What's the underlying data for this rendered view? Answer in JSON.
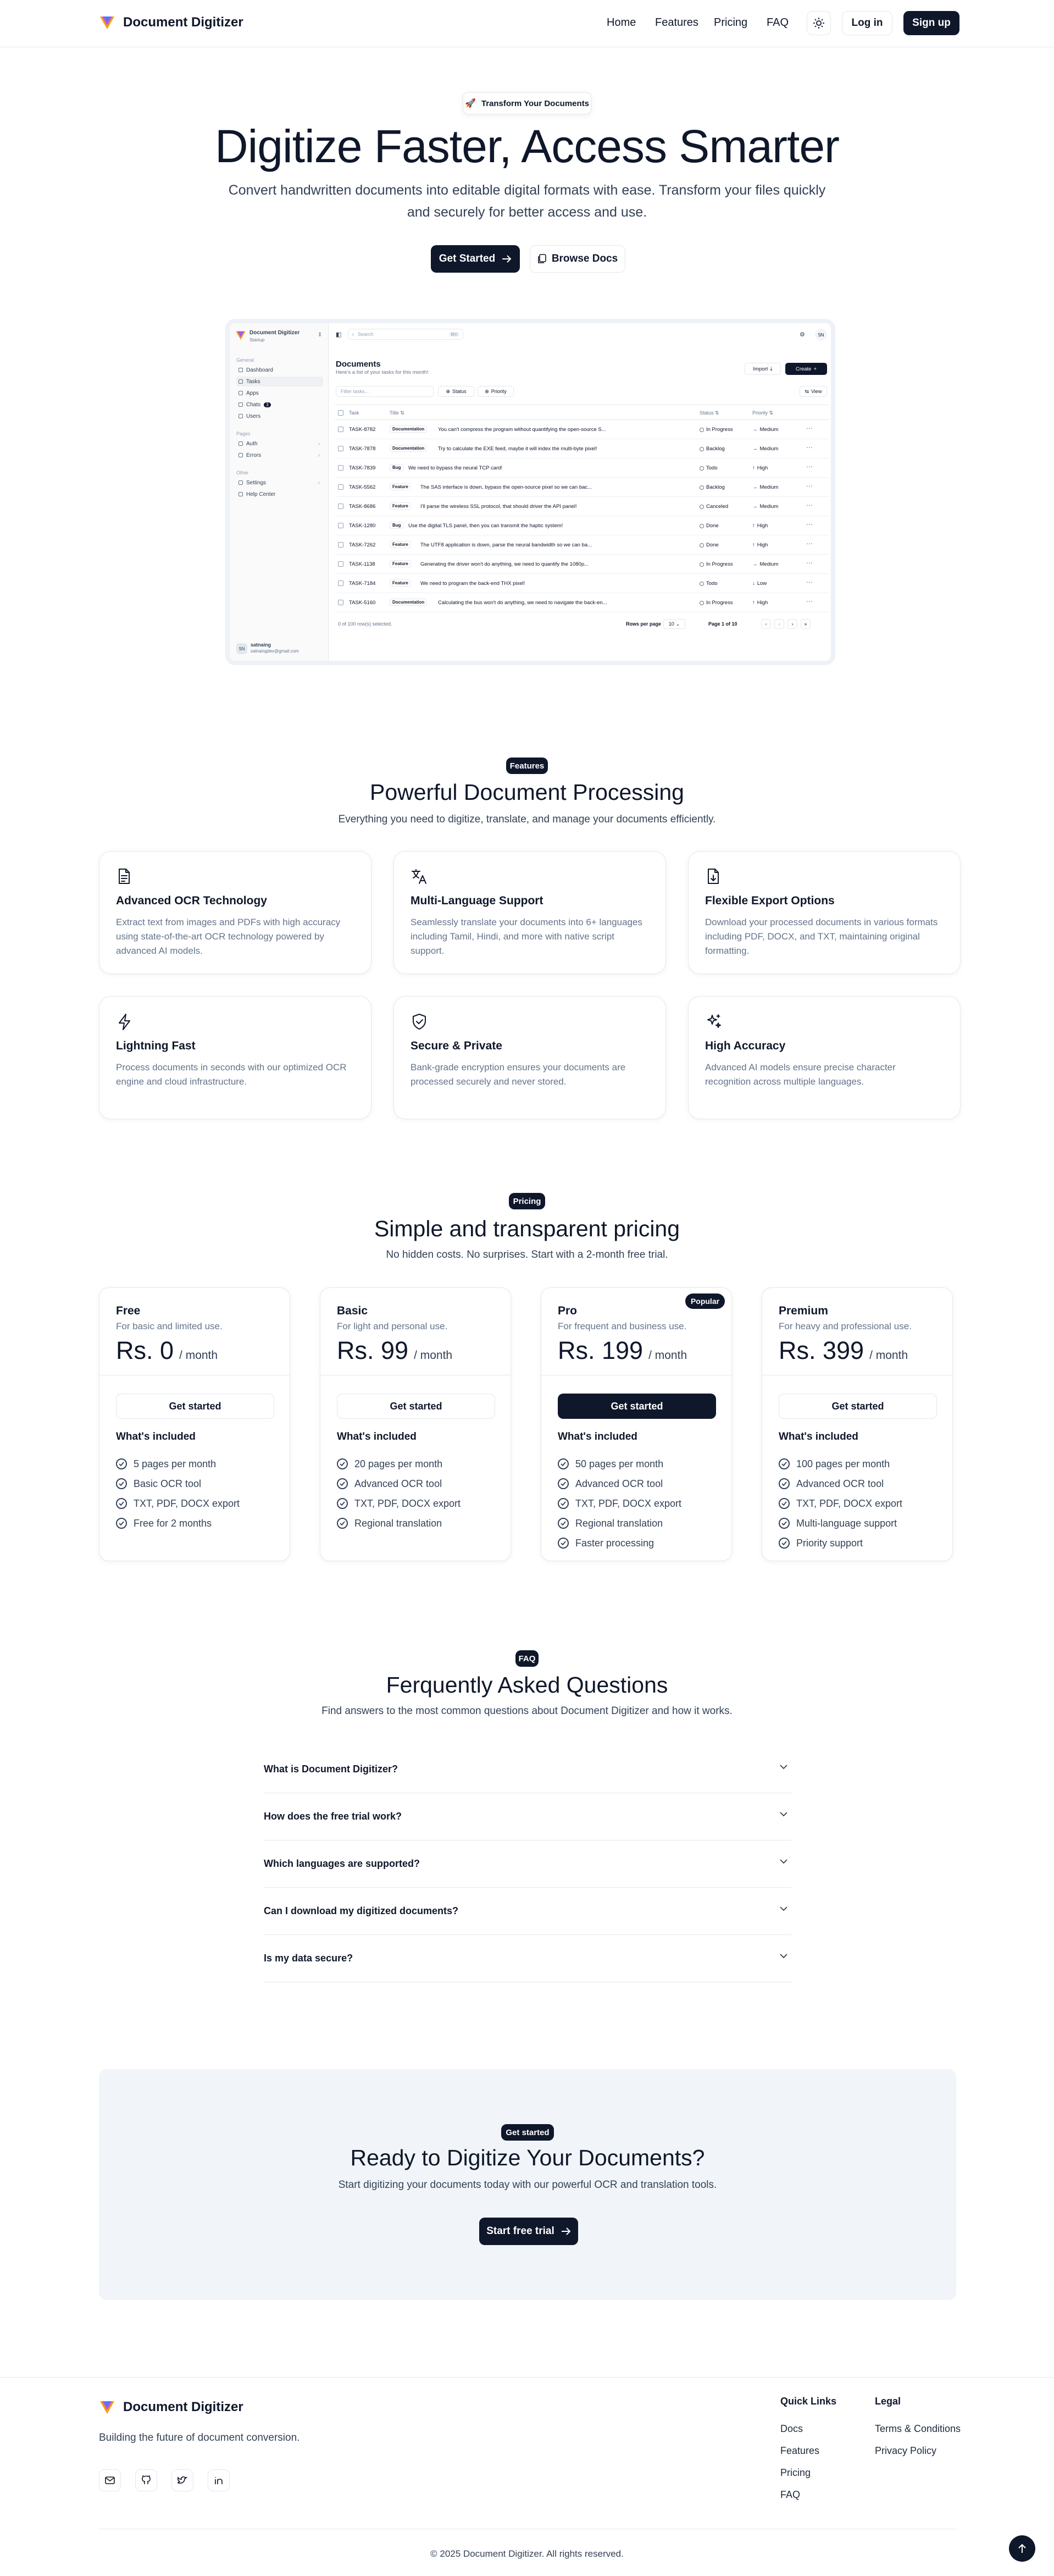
{
  "header": {
    "brand": "Document Digitizer",
    "nav": [
      "Home",
      "Features",
      "Pricing",
      "FAQ"
    ],
    "login": "Log in",
    "signup": "Sign up"
  },
  "hero": {
    "badge": "Transform Your Documents",
    "title": "Digitize Faster, Access Smarter",
    "subtitle_line1": "Convert handwritten documents into editable digital formats with ease. Transform your files quickly",
    "subtitle_line2": "and securely for better access and use.",
    "cta_primary": "Get Started",
    "cta_secondary": "Browse Docs"
  },
  "preview": {
    "team_name": "Document Digitizer",
    "team_plan": "Startup",
    "sections": {
      "general": "General",
      "pages": "Pages",
      "other": "Other"
    },
    "nav_general": [
      "Dashboard",
      "Tasks",
      "Apps",
      "Chats",
      "Users"
    ],
    "chats_badge": "3",
    "nav_pages": [
      "Auth",
      "Errors"
    ],
    "nav_other": [
      "Settings",
      "Help Center"
    ],
    "user_name": "satnaing",
    "user_email": "satnaingdev@gmail.com",
    "user_initials": "SN",
    "search_placeholder": "Search",
    "search_kbd": "⌘K",
    "avatar": "SN",
    "title": "Documents",
    "subtitle": "Here's a list of your tasks for this month!",
    "import": "Import",
    "create": "Create",
    "filter_placeholder": "Filter tasks...",
    "filter_status": "Status",
    "filter_priority": "Priority",
    "view": "View",
    "columns": [
      "Task",
      "Title",
      "Status",
      "Priority"
    ],
    "rows": [
      {
        "id": "TASK-8782",
        "tag": "Documentation",
        "title": "You can't compress the program without quantifying the open-source S...",
        "status": "In Progress",
        "priority": "Medium"
      },
      {
        "id": "TASK-7878",
        "tag": "Documentation",
        "title": "Try to calculate the EXE feed, maybe it will index the multi-byte pixel!",
        "status": "Backlog",
        "priority": "Medium"
      },
      {
        "id": "TASK-7839",
        "tag": "Bug",
        "title": "We need to bypass the neural TCP card!",
        "status": "Todo",
        "priority": "High"
      },
      {
        "id": "TASK-5562",
        "tag": "Feature",
        "title": "The SAS interface is down, bypass the open-source pixel so we can bac...",
        "status": "Backlog",
        "priority": "Medium"
      },
      {
        "id": "TASK-8686",
        "tag": "Feature",
        "title": "I'll parse the wireless SSL protocol, that should driver the API panel!",
        "status": "Canceled",
        "priority": "Medium"
      },
      {
        "id": "TASK-1280",
        "tag": "Bug",
        "title": "Use the digital TLS panel, then you can transmit the haptic system!",
        "status": "Done",
        "priority": "High"
      },
      {
        "id": "TASK-7262",
        "tag": "Feature",
        "title": "The UTF8 application is down, parse the neural bandwidth so we can ba...",
        "status": "Done",
        "priority": "High"
      },
      {
        "id": "TASK-1138",
        "tag": "Feature",
        "title": "Generating the driver won't do anything, we need to quantify the 1080p...",
        "status": "In Progress",
        "priority": "Medium"
      },
      {
        "id": "TASK-7184",
        "tag": "Feature",
        "title": "We need to program the back-end THX pixel!",
        "status": "Todo",
        "priority": "Low"
      },
      {
        "id": "TASK-5160",
        "tag": "Documentation",
        "title": "Calculating the bus won't do anything, we need to navigate the back-en...",
        "status": "In Progress",
        "priority": "High"
      }
    ],
    "selected": "0 of 100 row(s) selected.",
    "rows_per_page": "Rows per page",
    "rows_value": "10",
    "page_info": "Page 1 of 10"
  },
  "features": {
    "badge": "Features",
    "title": "Powerful Document Processing",
    "subtitle": "Everything you need to digitize, translate, and manage your documents efficiently.",
    "items": [
      {
        "icon": "file-text-icon",
        "title": "Advanced OCR Technology",
        "desc": "Extract text from images and PDFs with high accuracy using state-of-the-art OCR technology powered by advanced AI models."
      },
      {
        "icon": "languages-icon",
        "title": "Multi-Language Support",
        "desc": "Seamlessly translate your documents into 6+ languages including Tamil, Hindi, and more with native script support."
      },
      {
        "icon": "file-export-icon",
        "title": "Flexible Export Options",
        "desc": "Download your processed documents in various formats including PDF, DOCX, and TXT, maintaining original formatting."
      },
      {
        "icon": "zap-icon",
        "title": "Lightning Fast",
        "desc": "Process documents in seconds with our optimized OCR engine and cloud infrastructure."
      },
      {
        "icon": "shield-check-icon",
        "title": "Secure & Private",
        "desc": "Bank-grade encryption ensures your documents are processed securely and never stored."
      },
      {
        "icon": "sparkles-icon",
        "title": "High Accuracy",
        "desc": "Advanced AI models ensure precise character recognition across multiple languages."
      }
    ]
  },
  "pricing": {
    "badge": "Pricing",
    "title": "Simple and transparent pricing",
    "subtitle": "No hidden costs. No surprises. Start with a 2-month free trial.",
    "popular": "Popular",
    "per": "/ month",
    "cta": "Get started",
    "included": "What's included",
    "plans": [
      {
        "name": "Free",
        "desc": "For basic and limited use.",
        "price": "Rs. 0",
        "features": [
          "5 pages per month",
          "Basic OCR tool",
          "TXT, PDF, DOCX export",
          "Free for 2 months"
        ]
      },
      {
        "name": "Basic",
        "desc": "For light and personal use.",
        "price": "Rs. 99",
        "features": [
          "20 pages per month",
          "Advanced OCR tool",
          "TXT, PDF, DOCX export",
          "Regional translation"
        ]
      },
      {
        "name": "Pro",
        "desc": "For frequent and business use.",
        "price": "Rs. 199",
        "features": [
          "50 pages per month",
          "Advanced OCR tool",
          "TXT, PDF, DOCX export",
          "Regional translation",
          "Faster processing"
        ]
      },
      {
        "name": "Premium",
        "desc": "For heavy and professional use.",
        "price": "Rs. 399",
        "features": [
          "100 pages per month",
          "Advanced OCR tool",
          "TXT, PDF, DOCX export",
          "Multi-language support",
          "Priority support"
        ]
      }
    ]
  },
  "faq": {
    "badge": "FAQ",
    "title": "Ferquently Asked Questions",
    "subtitle": "Find answers to the most common questions about Document Digitizer and how it works.",
    "items": [
      "What is Document Digitizer?",
      "How does the free trial work?",
      "Which languages are supported?",
      "Can I download my digitized documents?",
      "Is my data secure?"
    ]
  },
  "cta": {
    "badge": "Get started",
    "title": "Ready to Digitize Your Documents?",
    "subtitle": "Start digitizing your documents today with our powerful OCR and translation tools.",
    "button": "Start free trial"
  },
  "footer": {
    "brand": "Document Digitizer",
    "tagline": "Building the future of document conversion.",
    "quick_links_title": "Quick Links",
    "quick_links": [
      "Docs",
      "Features",
      "Pricing",
      "FAQ"
    ],
    "legal_title": "Legal",
    "legal": [
      "Terms & Conditions",
      "Privacy Policy"
    ],
    "copyright": "© 2025 Document Digitizer. All rights reserved.",
    "social": [
      "mail-icon",
      "github-icon",
      "twitter-icon",
      "linkedin-icon"
    ]
  }
}
